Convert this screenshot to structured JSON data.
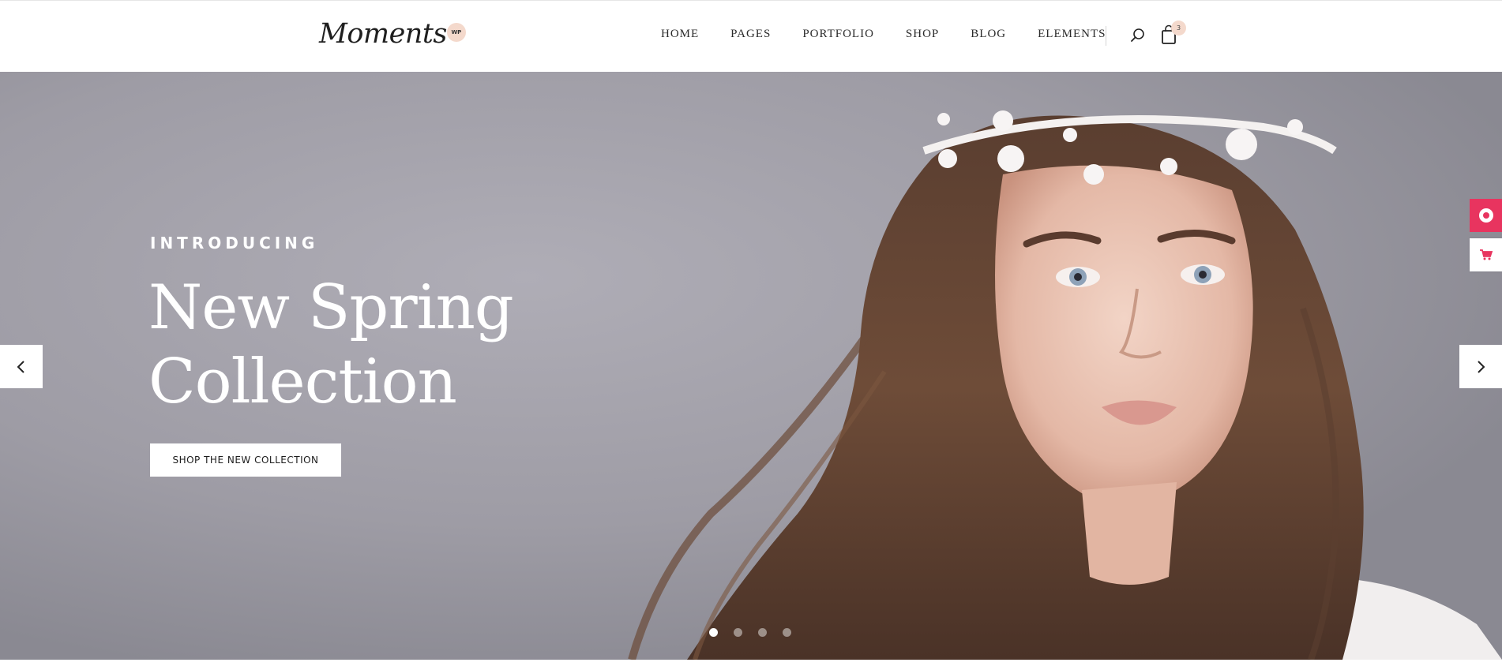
{
  "brand": {
    "logo_text": "Moments",
    "badge": "WP"
  },
  "nav": {
    "items": [
      "HOME",
      "PAGES",
      "PORTFOLIO",
      "SHOP",
      "BLOG",
      "ELEMENTS"
    ],
    "cart_count": "3",
    "search_icon": "search-icon",
    "cart_icon": "shopping-bag-icon"
  },
  "hero": {
    "eyebrow": "INTRODUCING",
    "title_line1": "New Spring",
    "title_line2": "Collection",
    "cta_label": "SHOP THE NEW COLLECTION",
    "slides_total": 4,
    "active_slide": 1,
    "prev_icon": "chevron-left-icon",
    "next_icon": "chevron-right-icon"
  },
  "side_widgets": [
    {
      "icon": "lifebuoy-icon",
      "color": "#e8345f"
    },
    {
      "icon": "cart-icon",
      "color": "#e8345f"
    }
  ],
  "colors": {
    "accent": "#e8345f",
    "badge_bg": "#f4d9cc",
    "hero_bg": "#9c9aa3",
    "text_dark": "#2b2b2b"
  }
}
